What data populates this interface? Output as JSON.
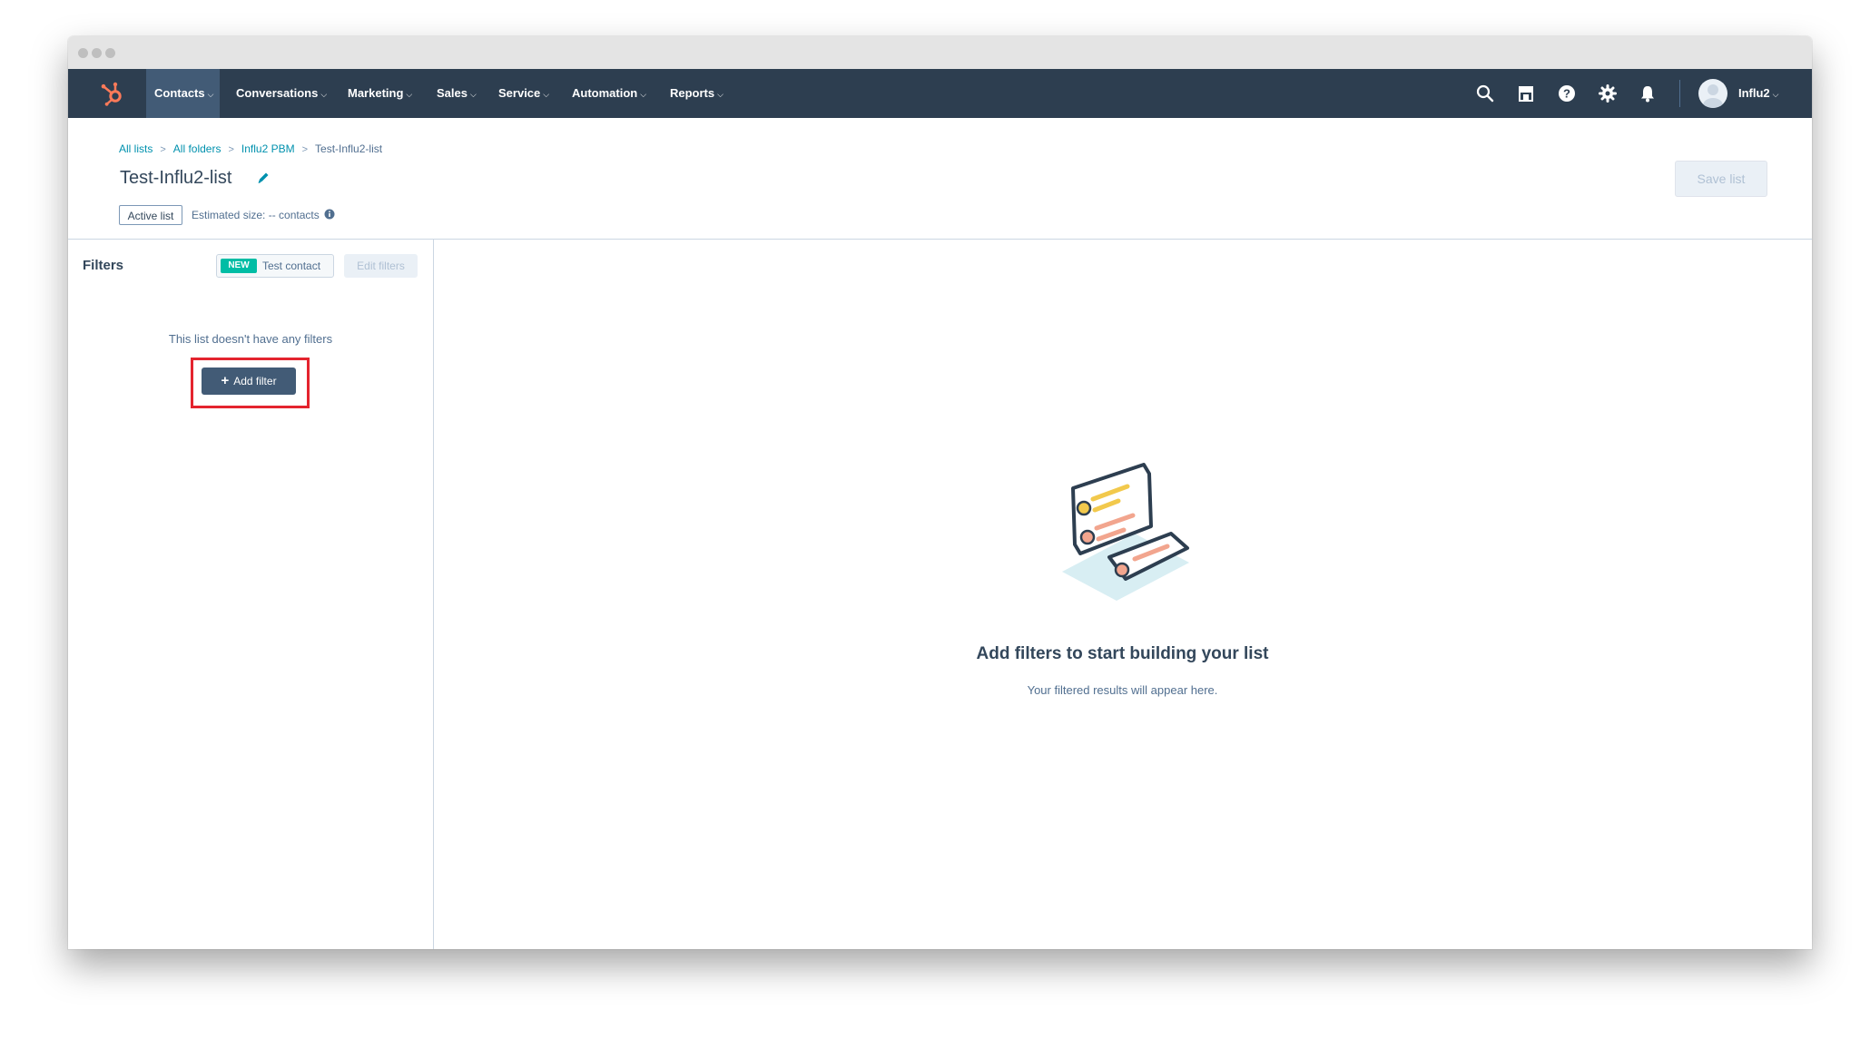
{
  "nav": {
    "items": [
      {
        "label": "Contacts",
        "active": true
      },
      {
        "label": "Conversations"
      },
      {
        "label": "Marketing"
      },
      {
        "label": "Sales"
      },
      {
        "label": "Service"
      },
      {
        "label": "Automation"
      },
      {
        "label": "Reports"
      }
    ],
    "icons": [
      "search-icon",
      "marketplace-icon",
      "help-icon",
      "settings-icon",
      "notifications-icon"
    ],
    "account_label": "Influ2"
  },
  "breadcrumb": [
    "All lists",
    "All folders",
    "Influ2 PBM",
    "Test-Influ2-list"
  ],
  "list": {
    "title": "Test-Influ2-list",
    "status_badge": "Active list",
    "estimated_size": "Estimated size: -- contacts"
  },
  "save_button": "Save list",
  "filters": {
    "title": "Filters",
    "new_badge": "NEW",
    "test_contact_label": "Test contact",
    "edit_filters_label": "Edit filters",
    "empty_text": "This list doesn't have any filters",
    "add_filter_label": "Add filter"
  },
  "empty_state": {
    "title": "Add filters to start building your list",
    "subtitle": "Your filtered results will appear here."
  },
  "colors": {
    "nav_bg": "#2d3e50",
    "accent": "#ff7a59",
    "link": "#0091ae",
    "badge_new": "#00bda5",
    "button_dark": "#425b76",
    "highlight": "#e4242e"
  }
}
